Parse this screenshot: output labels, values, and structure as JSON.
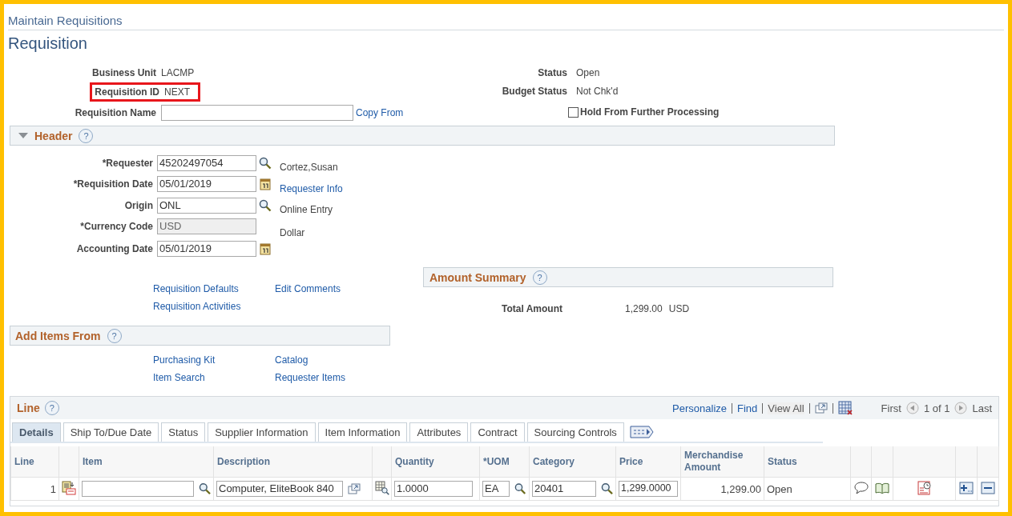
{
  "breadcrumb": "Maintain Requisitions",
  "title": "Requisition",
  "summary_left": [
    {
      "label": "Business Unit",
      "value": "LACMP",
      "highlighted": false
    },
    {
      "label": "Requisition ID",
      "value": "NEXT",
      "highlighted": true
    }
  ],
  "requisition_name": {
    "label": "Requisition Name",
    "link": "Copy From"
  },
  "summary_right": [
    {
      "label": "Status",
      "value": "Open"
    },
    {
      "label": "Budget Status",
      "value": "Not Chk'd"
    }
  ],
  "hold": {
    "label": "Hold From Further Processing",
    "checked": false
  },
  "header": {
    "title": "Header",
    "help": "?",
    "expanded": true,
    "fields": [
      {
        "label": "*Requester",
        "value": "45202497054",
        "kind": "lookup",
        "disabled": false,
        "side": {
          "text": "Cortez,Susan",
          "link": false
        }
      },
      {
        "label": "*Requisition Date",
        "value": "05/01/2019",
        "kind": "date",
        "disabled": false,
        "side": {
          "text": "Requester Info",
          "link": true
        }
      },
      {
        "label": "Origin",
        "value": "ONL",
        "kind": "lookup",
        "disabled": false,
        "side": {
          "text": "Online Entry",
          "link": false
        }
      },
      {
        "label": "*Currency Code",
        "value": "USD",
        "kind": "text",
        "disabled": true,
        "side": {
          "text": "Dollar",
          "link": false
        }
      },
      {
        "label": "Accounting Date",
        "value": "05/01/2019",
        "kind": "date",
        "disabled": false
      }
    ],
    "links": [
      [
        "Requisition Defaults",
        "Requisition Activities"
      ],
      [
        "Edit Comments"
      ]
    ]
  },
  "amount_summary": {
    "title": "Amount Summary",
    "help": "?",
    "label": "Total Amount",
    "value": "1,299.00",
    "currency": "USD"
  },
  "add_items": {
    "title": "Add Items From",
    "help": "?",
    "links": [
      [
        "Purchasing Kit",
        "Item Search"
      ],
      [
        "Catalog",
        "Requester Items"
      ]
    ]
  },
  "line": {
    "title": "Line",
    "help": "?",
    "toolbar": [
      {
        "label": "Personalize",
        "disabled": false
      },
      {
        "label": "Find",
        "disabled": false
      },
      {
        "label": "View All",
        "disabled": true
      }
    ],
    "pager": {
      "first": "First",
      "range": "1 of 1",
      "last": "Last"
    },
    "tabs": [
      {
        "label": "Details",
        "selected": true
      },
      {
        "label": "Ship To/Due Date",
        "selected": false
      },
      {
        "label": "Status",
        "selected": false
      },
      {
        "label": "Supplier Information",
        "selected": false
      },
      {
        "label": "Item Information",
        "selected": false
      },
      {
        "label": "Attributes",
        "selected": false
      },
      {
        "label": "Contract",
        "selected": false
      },
      {
        "label": "Sourcing Controls",
        "selected": false
      }
    ],
    "columns": {
      "line": "Line",
      "item": "Item",
      "description": "Description",
      "quantity": "Quantity",
      "uom": "*UOM",
      "category": "Category",
      "price": "Price",
      "amount": "Merchandise Amount",
      "status": "Status"
    },
    "rows": [
      {
        "line": "1",
        "description": "Computer, EliteBook 840",
        "quantity": "1.0000",
        "uom": "EA",
        "category": "20401",
        "price": "1,299.0000",
        "amount": "1,299.00",
        "status": "Open"
      }
    ]
  }
}
